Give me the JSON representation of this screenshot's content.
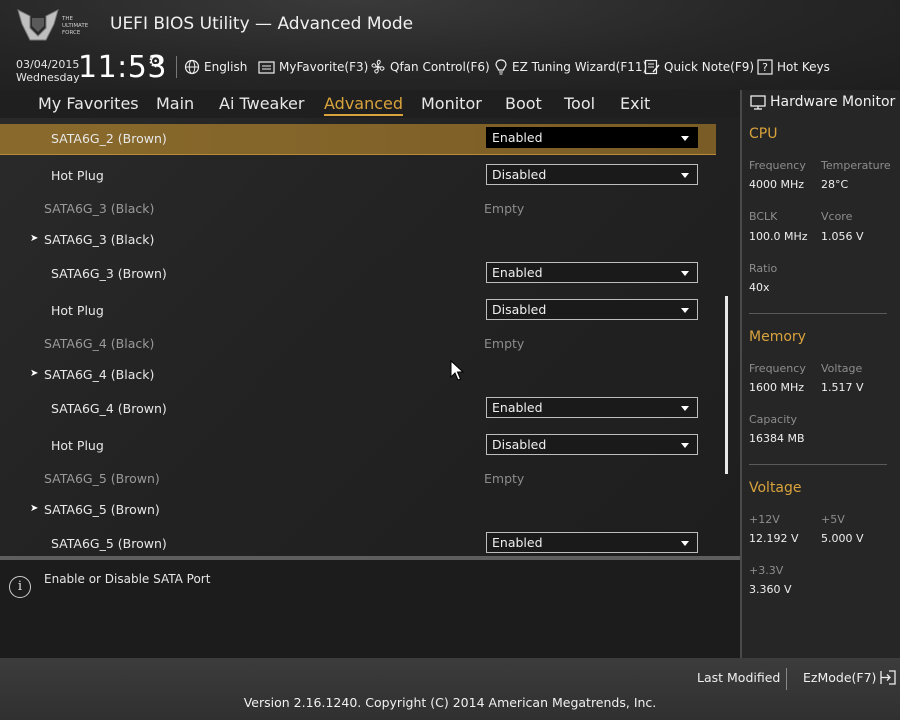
{
  "header": {
    "title": "UEFI BIOS Utility — Advanced Mode",
    "date": "03/04/2015",
    "day": "Wednesday",
    "time": "11:53",
    "toolbar": [
      {
        "label": "English",
        "icon": "globe-icon"
      },
      {
        "label": "MyFavorite(F3)",
        "icon": "favorite-icon"
      },
      {
        "label": "Qfan Control(F6)",
        "icon": "fan-icon"
      },
      {
        "label": "EZ Tuning Wizard(F11)",
        "icon": "lightbulb-icon"
      },
      {
        "label": "Quick Note(F9)",
        "icon": "note-icon"
      },
      {
        "label": "Hot Keys",
        "icon": "question-icon"
      }
    ]
  },
  "tabs": [
    "My Favorites",
    "Main",
    "Ai Tweaker",
    "Advanced",
    "Monitor",
    "Boot",
    "Tool",
    "Exit"
  ],
  "active_tab": "Advanced",
  "settings": [
    {
      "label": "SATA6G_2 (Brown)",
      "type": "select",
      "value": "Enabled",
      "selected": true
    },
    {
      "label": "Hot Plug",
      "type": "select",
      "value": "Disabled"
    },
    {
      "label": "SATA6G_3 (Black)",
      "type": "info",
      "value": "Empty"
    },
    {
      "label": "SATA6G_3 (Black)",
      "type": "submenu"
    },
    {
      "label": "SATA6G_3 (Brown)",
      "type": "select",
      "value": "Enabled"
    },
    {
      "label": "Hot Plug",
      "type": "select",
      "value": "Disabled"
    },
    {
      "label": "SATA6G_4 (Black)",
      "type": "info",
      "value": "Empty"
    },
    {
      "label": "SATA6G_4 (Black)",
      "type": "submenu"
    },
    {
      "label": "SATA6G_4 (Brown)",
      "type": "select",
      "value": "Enabled"
    },
    {
      "label": "Hot Plug",
      "type": "select",
      "value": "Disabled"
    },
    {
      "label": "SATA6G_5 (Brown)",
      "type": "info",
      "value": "Empty"
    },
    {
      "label": "SATA6G_5 (Brown)",
      "type": "submenu"
    },
    {
      "label": "SATA6G_5 (Brown)",
      "type": "select",
      "value": "Enabled"
    }
  ],
  "help": {
    "text": "Enable or Disable SATA Port",
    "icon": "i"
  },
  "hardware_monitor": {
    "title": "Hardware Monitor",
    "cpu": {
      "heading": "CPU",
      "frequency_label": "Frequency",
      "frequency": "4000 MHz",
      "temperature_label": "Temperature",
      "temperature": "28°C",
      "bclk_label": "BCLK",
      "bclk": "100.0 MHz",
      "vcore_label": "Vcore",
      "vcore": "1.056 V",
      "ratio_label": "Ratio",
      "ratio": "40x"
    },
    "memory": {
      "heading": "Memory",
      "frequency_label": "Frequency",
      "frequency": "1600 MHz",
      "voltage_label": "Voltage",
      "voltage": "1.517 V",
      "capacity_label": "Capacity",
      "capacity": "16384 MB"
    },
    "voltage": {
      "heading": "Voltage",
      "v12_label": "+12V",
      "v12": "12.192 V",
      "v5_label": "+5V",
      "v5": "5.000 V",
      "v33_label": "+3.3V",
      "v33": "3.360 V"
    }
  },
  "footer": {
    "last_modified": "Last Modified",
    "ezmode": "EzMode(F7)",
    "version": "Version 2.16.1240. Copyright (C) 2014 American Megatrends, Inc."
  },
  "colors": {
    "accent": "#d9a33c",
    "selected_row": "#8a6a2c",
    "background": "#1c1c1c"
  }
}
